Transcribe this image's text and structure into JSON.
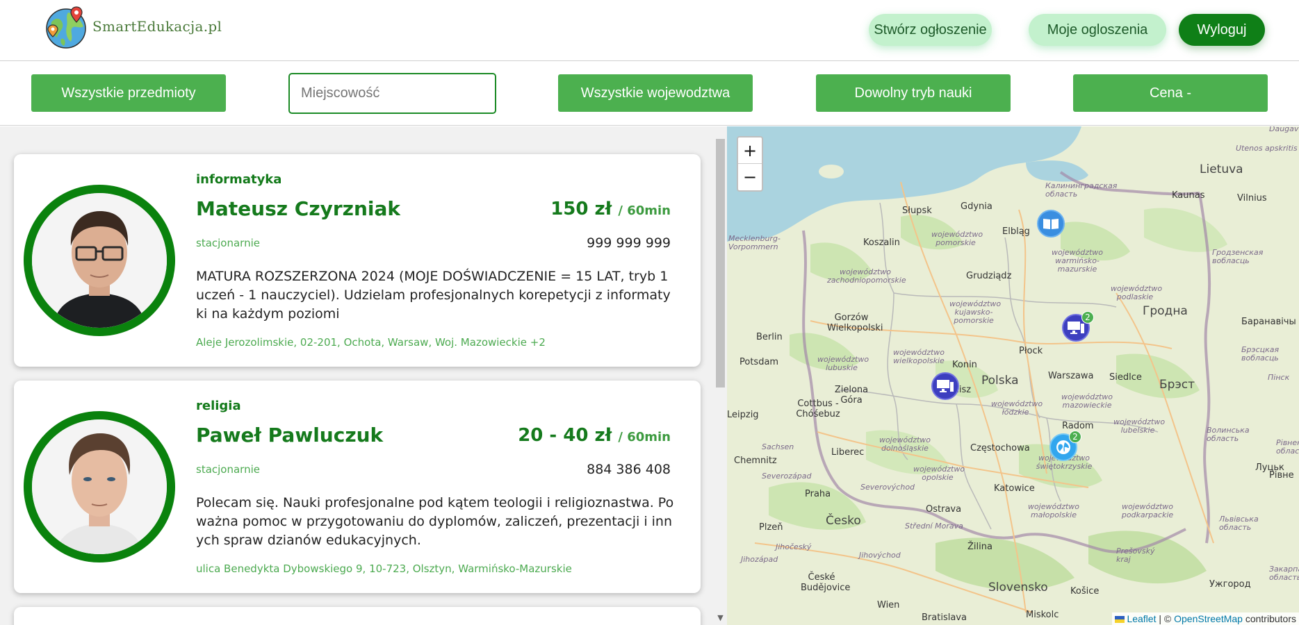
{
  "header": {
    "brand": "SmartEdukacja.pl",
    "create_label": "Stwórz ogłoszenie",
    "my_ads_label": "Moje ogloszenia",
    "logout_label": "Wyloguj"
  },
  "filters": {
    "subjects_label": "Wszystkie przedmioty",
    "city_placeholder": "Miejscowość",
    "voivodeship_label": "Wszystkie wojewodztwa",
    "mode_label": "Dowolny tryb nauki",
    "price_label": "Cena -"
  },
  "listings": [
    {
      "subject": "informatyka",
      "name": "Mateusz Czyrzniak",
      "price": "150 zł",
      "per": "/ 60min",
      "mode": "stacjonarnie",
      "phone": "999 999 999",
      "description": "MATURA ROZSZERZONA 2024 (MOJE DOŚWIADCZENIE = 15 LAT, tryb 1 uczeń - 1 nauczyciel). Udzielam profesjonalnych korepetycji z informatyki na każdym poziomi",
      "address": "Aleje Jerozolimskie, 02-201, Ochota, Warsaw, Woj. Mazowieckie +2"
    },
    {
      "subject": "religia",
      "name": "Paweł Pawluczuk",
      "price": "20 - 40 zł",
      "per": "/ 60min",
      "mode": "stacjonarnie",
      "phone": "884 386 408",
      "description": "Polecam się. Nauki profesjonalne pod kątem teologii i religioznastwa. Poważna pomoc w przygotowaniu do dyplomów, zaliczeń, prezentacji i innych spraw dzianów edukacyjnych.",
      "address": "ulica Benedykta Dybowskiego 9, 10-723, Olsztyn, Warmińsko-Mazurskie"
    }
  ],
  "map": {
    "zoom_in": "+",
    "zoom_out": "−",
    "attribution_leaflet": "Leaflet",
    "attribution_sep": " | © ",
    "attribution_osm": "OpenStreetMap",
    "attribution_tail": " contributors",
    "labels": {
      "lietuva": "Lietuva",
      "polska": "Polska",
      "cesko": "Česko",
      "slovensko": "Slovensko",
      "berlin": "Berlin",
      "praha": "Praha",
      "wien": "Wien",
      "bratislava": "Bratislava",
      "hrodna": "Гродна",
      "brest": "Брэст",
      "lutsk": "Луцьк",
      "rivne": "Рівне",
      "uzhhorod": "Ужгород",
      "kosice": "Košice",
      "gdynia": "Gdynia",
      "slupsk": "Słupsk",
      "koszalin": "Koszalin",
      "elblag": "Elbląg",
      "grudziadz": "Grudziądz",
      "gorzow": "Gorzów Wielkopolski",
      "potsdam": "Potsdam",
      "zielona": "Zielona Góra",
      "cottbus": "Cottbus - Chóśebuz",
      "konin": "Konin",
      "plock": "Płock",
      "kalisz": "Kalisz",
      "warszawa": "Warszawa",
      "siedlce": "Siedlce",
      "radom": "Radom",
      "czestochowa": "Częstochowa",
      "katowice": "Katowice",
      "liberec": "Liberec",
      "chemnitz": "Chemnitz",
      "ostrava": "Ostrava",
      "plzen": "Plzeň",
      "zilina": "Žilina",
      "kaunas": "Kaunas",
      "vilnius": "Vilnius",
      "utenos": "Utenos apskritis",
      "kaliningrad": "Калининградская область",
      "grodno_obl": "Гродзенская вобласць",
      "baranavichy": "Баранавічы",
      "brest_obl": "Брэсцкая вобласць",
      "pinsk": "Пінск",
      "volyn": "Волинська область",
      "rivne_obl": "Рівненська область",
      "lviv_obl": "Львівська область",
      "zak_obl": "Закарпатська область",
      "budejovice": "České Budějovice",
      "miskolc": "Miskolc",
      "presov": "Prešovský kraj",
      "ceske": "Severozápad",
      "sachsen": "Sachsen",
      "jihocesky": "Jihočeský",
      "jihozapad": "Jihozápad",
      "jihovychod": "Jihovýchod",
      "strednimorava": "Střední Morava",
      "severovychod": "Severovýchod",
      "daugav": "Daugav",
      "mecklenburg": "Mecklenburg-Vorpommern",
      "pomorskie": "województwo pomorskie",
      "warminsko": "województwo warmińsko-mazurskie",
      "zachodniopomorskie": "województwo zachodniopomorskie",
      "kujawsko": "województwo kujawsko-pomorskie",
      "podlaskie": "województwo podlaskie",
      "lubuskie": "województwo lubuskie",
      "wielkopolskie": "województwo wielkopolskie",
      "mazowieckie": "województwo mazowieckie",
      "lodzkie": "województwo łódzkie",
      "lubelskie": "województwo lubelskie",
      "dolnoslaskie": "województwo dolnośląskie",
      "opolskie": "województwo opolskie",
      "swietokrzyskie": "województwo świętokrzyskie",
      "malopolskie": "województwo małopolskie",
      "podkarpackie": "województwo podkarpackie",
      "leipzig": "Leipzig"
    },
    "markers": [
      {
        "badge": ""
      },
      {
        "badge": "2"
      },
      {
        "badge": ""
      },
      {
        "badge": "2"
      }
    ]
  }
}
